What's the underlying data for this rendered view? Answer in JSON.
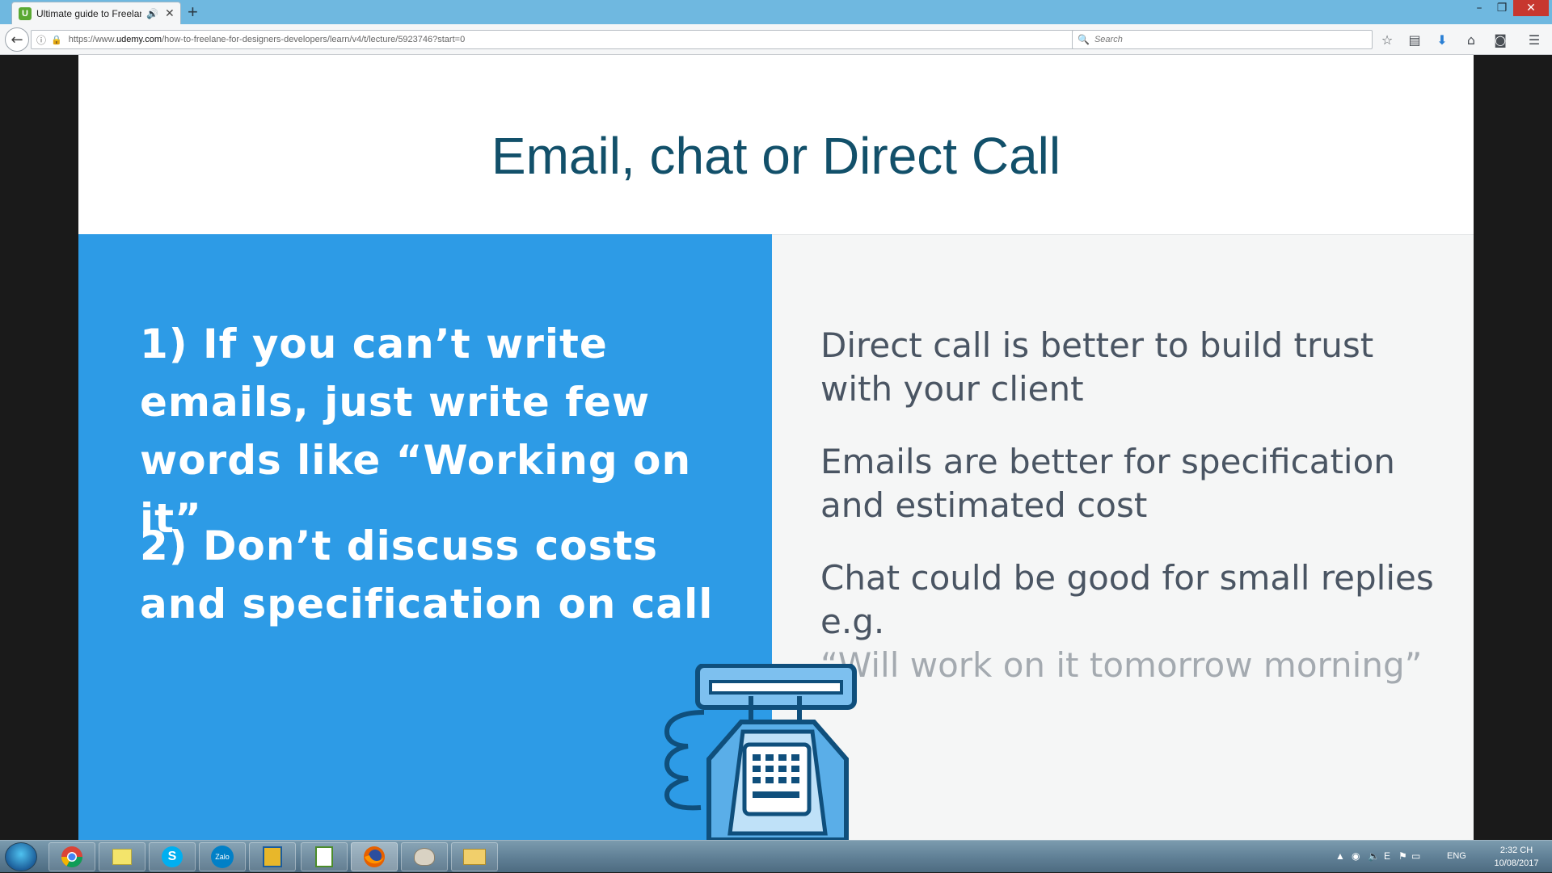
{
  "browser": {
    "tab": {
      "title": "Ultimate guide to Freelan",
      "favicon_letter": "U",
      "audio_icon": "speaker-icon",
      "close_glyph": "✕"
    },
    "new_tab_glyph": "+",
    "window_controls": {
      "minimize": "–",
      "restore": "❐",
      "close": "✕"
    },
    "url": {
      "prefix": "https://www.",
      "domain": "udemy.com",
      "path": "/how-to-freelane-for-designers-developers/learn/v4/t/lecture/5923746?start=0"
    },
    "search_placeholder": "Search",
    "toolbar_icons": [
      "star-icon",
      "reading-list-icon",
      "download-icon",
      "home-icon",
      "pocket-icon",
      "menu-icon"
    ]
  },
  "slide": {
    "title": "Email, chat or Direct Call",
    "left_points": [
      "1) If you can’t write emails, just write few words like “Working on it”",
      "2) Don’t discuss costs and specification on call"
    ],
    "right_points": [
      "Direct call is better to build trust with your client",
      "Emails are better for specification and estimated cost",
      "Chat could be good for small replies e.g."
    ],
    "right_quote": "“Will work on it tomorrow morning”",
    "colors": {
      "title": "#12506a",
      "left_panel": "#2d9be6",
      "right_panel": "#f5f6f6",
      "right_text": "#4a5563",
      "quote_text": "#a4aab0"
    }
  },
  "taskbar": {
    "apps": [
      "chrome-icon",
      "sticky-notes-icon",
      "skype-icon",
      "zalo-icon",
      "file-manager-icon",
      "notepad-icon",
      "firefox-icon",
      "paint-icon",
      "explorer-icon"
    ],
    "zalo_label": "Zalo",
    "skype_label": "S",
    "language": "ENG",
    "time": "2:32 CH",
    "date": "10/08/2017"
  }
}
